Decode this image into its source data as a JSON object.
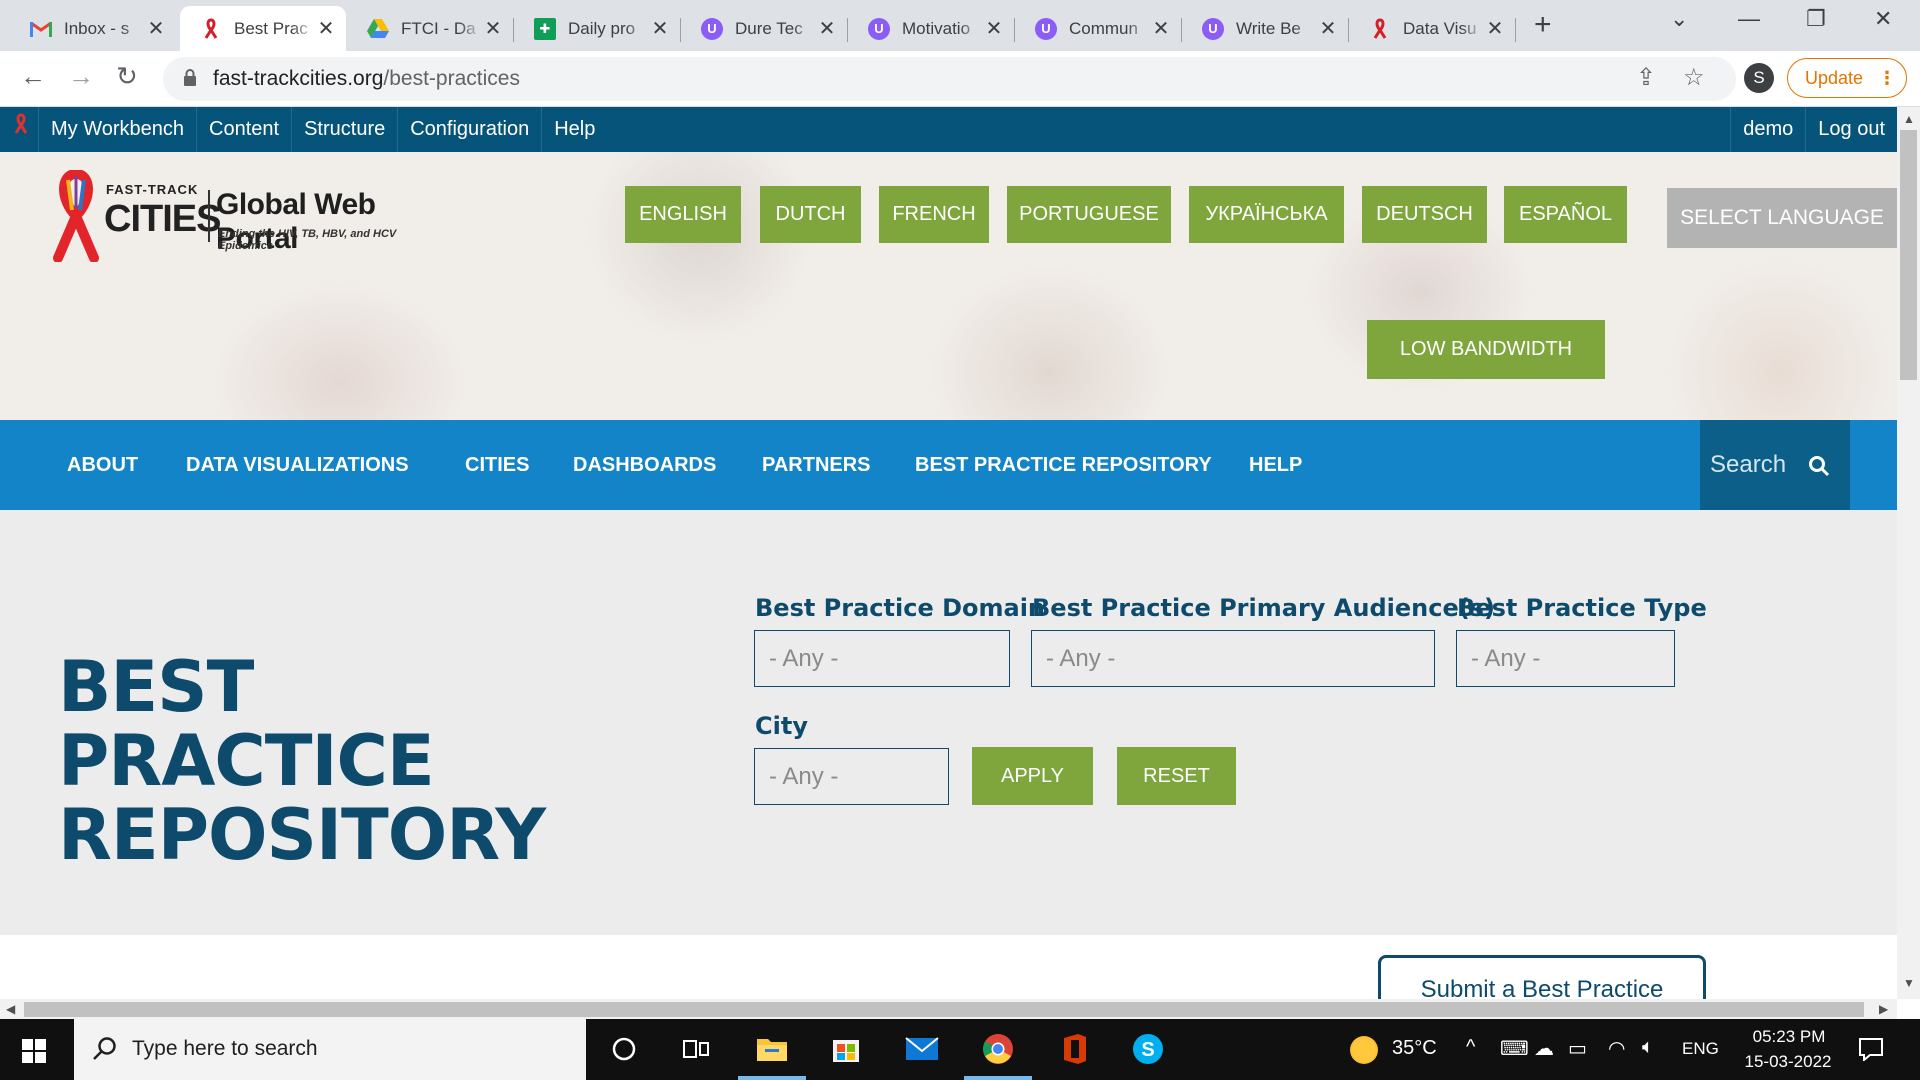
{
  "browser": {
    "tabs": [
      {
        "title": "Inbox - s",
        "favicon": "gmail-icon",
        "active": false
      },
      {
        "title": "Best Prac",
        "favicon": "ribbon-icon",
        "active": true
      },
      {
        "title": "FTCI - Da",
        "favicon": "google-drive-icon",
        "active": false
      },
      {
        "title": "Daily pro",
        "favicon": "google-sheets-icon",
        "active": false
      },
      {
        "title": "Dure Tec",
        "favicon": "purple-u-icon",
        "active": false
      },
      {
        "title": "Motivatio",
        "favicon": "purple-u-icon",
        "active": false
      },
      {
        "title": "Commun",
        "favicon": "purple-u-icon",
        "active": false
      },
      {
        "title": "Write Be",
        "favicon": "purple-u-icon",
        "active": false
      },
      {
        "title": "Data Visu",
        "favicon": "ribbon-icon",
        "active": false
      }
    ],
    "url_domain": "fast-trackcities.org",
    "url_path": "/best-practices",
    "profile_initial": "S",
    "update_label": "Update",
    "update_dots": "⋮"
  },
  "admin_bar": {
    "left": [
      "My Workbench",
      "Content",
      "Structure",
      "Configuration",
      "Help"
    ],
    "right": [
      "demo",
      "Log out"
    ]
  },
  "header": {
    "logo_small": "FAST-TRACK",
    "logo_cities": "CITIES",
    "portal_name": "Global Web Portal",
    "portal_tagline": "Ending the HIV, TB, HBV, and HCV Epidemics",
    "languages": [
      "ENGLISH",
      "DUTCH",
      "FRENCH",
      "PORTUGUESE",
      "УКРАЇНСЬКА",
      "DEUTSCH",
      "ESPAÑOL"
    ],
    "select_language": "SELECT LANGUAGE",
    "low_bandwidth": "LOW BANDWIDTH"
  },
  "main_nav": {
    "items": [
      "ABOUT",
      "DATA VISUALIZATIONS",
      "CITIES",
      "DASHBOARDS",
      "PARTNERS",
      "BEST PRACTICE REPOSITORY",
      "HELP"
    ],
    "search_placeholder": "Search"
  },
  "content": {
    "title_line1": "BEST PRACTICE",
    "title_line2": "REPOSITORY",
    "filters": {
      "domain_label": "Best Practice Domain",
      "domain_value": "- Any -",
      "audience_label": "Best Practice Primary Audience(s)",
      "audience_value": "- Any -",
      "type_label": "Best Practice Type",
      "type_value": "- Any -",
      "city_label": "City",
      "city_value": "- Any -"
    },
    "apply_label": "APPLY",
    "reset_label": "RESET",
    "submit_label": "Submit a Best Practice"
  },
  "taskbar": {
    "search_placeholder": "Type here to search",
    "temperature": "35°C",
    "language": "ENG",
    "time": "05:23 PM",
    "date": "15-03-2022"
  },
  "colors": {
    "admin_bar": "#065479",
    "main_nav": "#1284c7",
    "green_button": "#7ea63c",
    "title_navy": "#0d4a6b",
    "update_orange": "#e37400"
  }
}
